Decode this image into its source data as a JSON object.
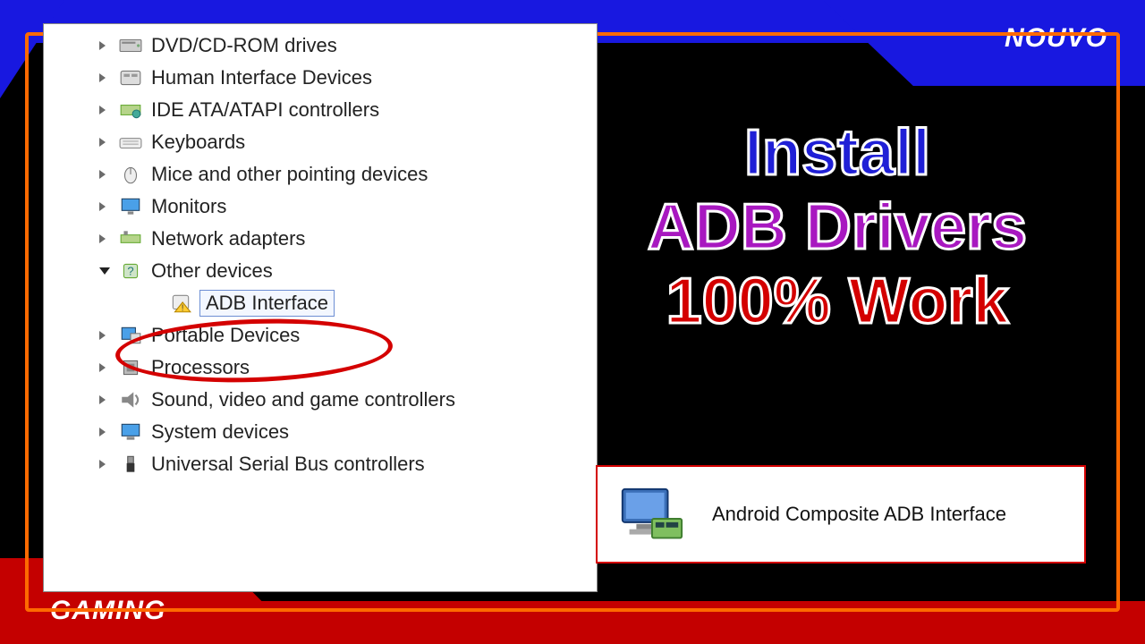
{
  "brand": {
    "top": "NOUVO",
    "bottom": "GAMING"
  },
  "title": {
    "line1": "Install",
    "line2": "ADB Drivers",
    "line3": "100% Work"
  },
  "resultCard": {
    "label": "Android Composite ADB Interface"
  },
  "tree": {
    "items": [
      {
        "label": "DVD/CD-ROM drives",
        "icon": "disc-drive"
      },
      {
        "label": "Human Interface Devices",
        "icon": "hid"
      },
      {
        "label": "IDE ATA/ATAPI controllers",
        "icon": "ide"
      },
      {
        "label": "Keyboards",
        "icon": "keyboard"
      },
      {
        "label": "Mice and other pointing devices",
        "icon": "mouse"
      },
      {
        "label": "Monitors",
        "icon": "monitor"
      },
      {
        "label": "Network adapters",
        "icon": "network"
      },
      {
        "label": "Other devices",
        "icon": "other",
        "expanded": true
      },
      {
        "label": "Portable Devices",
        "icon": "portable"
      },
      {
        "label": "Processors",
        "icon": "cpu"
      },
      {
        "label": "Sound, video and game controllers",
        "icon": "sound"
      },
      {
        "label": "System devices",
        "icon": "system"
      },
      {
        "label": "Universal Serial Bus controllers",
        "icon": "usb"
      }
    ],
    "child": {
      "label": "ADB Interface",
      "icon": "warning-device"
    }
  }
}
